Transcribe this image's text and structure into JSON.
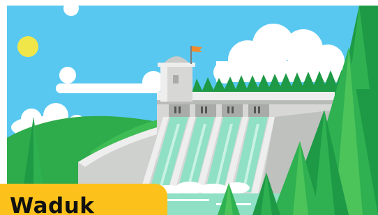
{
  "illustration": {
    "subject": "dam-landscape",
    "colors": {
      "sky": "#59c8f1",
      "sun": "#f0e64a",
      "cloud": "#ffffff",
      "dam": "#d7d8d6",
      "dam_shadow": "#a9aba8",
      "water": "#8fe0c5",
      "forest_dark": "#1e9a46",
      "forest_light": "#4cc45a",
      "hill": "#2eab4a",
      "flag": "#f08a2b"
    }
  },
  "title": {
    "text": "Waduk",
    "badge_color": "#fcc21b",
    "text_color": "#111111"
  }
}
